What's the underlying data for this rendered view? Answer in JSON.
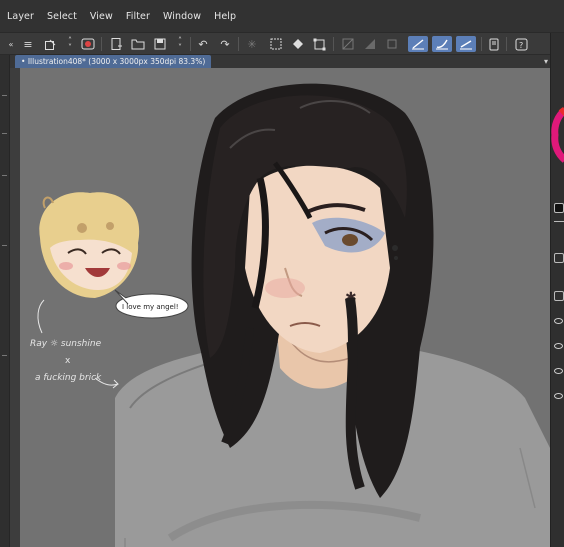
{
  "menu": {
    "items": [
      "Layer",
      "Select",
      "View",
      "Filter",
      "Window",
      "Help"
    ]
  },
  "document": {
    "tab_title": "Illustration408* (3000 x 3000px 350dpi 83.3%)",
    "tab_dot": "•"
  },
  "toolbar": {
    "icons": [
      "menu-icon",
      "new-canvas-icon",
      "stepper-icon",
      "eye-target-icon",
      "new-file-icon",
      "open-folder-icon",
      "save-icon",
      "stepper-icon",
      "undo-icon",
      "redo-icon",
      "loading-icon",
      "clear-icon",
      "fill-icon",
      "transform-icon",
      "snap-off-icon",
      "snap-gray-icon",
      "snap-box-icon",
      "pen-ruler-icon",
      "pen-brush-icon",
      "pen-angle-icon",
      "device-icon",
      "help-icon"
    ]
  },
  "artwork": {
    "speech_bubble": "I love my angel!",
    "annotation_line1": "Ray ☼ sunshine",
    "annotation_x": "x",
    "annotation_line2": "a fucking brick"
  },
  "colors": {
    "accent": "#5c7fb8",
    "tab": "#4f6b96",
    "canvas": "#727272",
    "panel": "#323232"
  }
}
